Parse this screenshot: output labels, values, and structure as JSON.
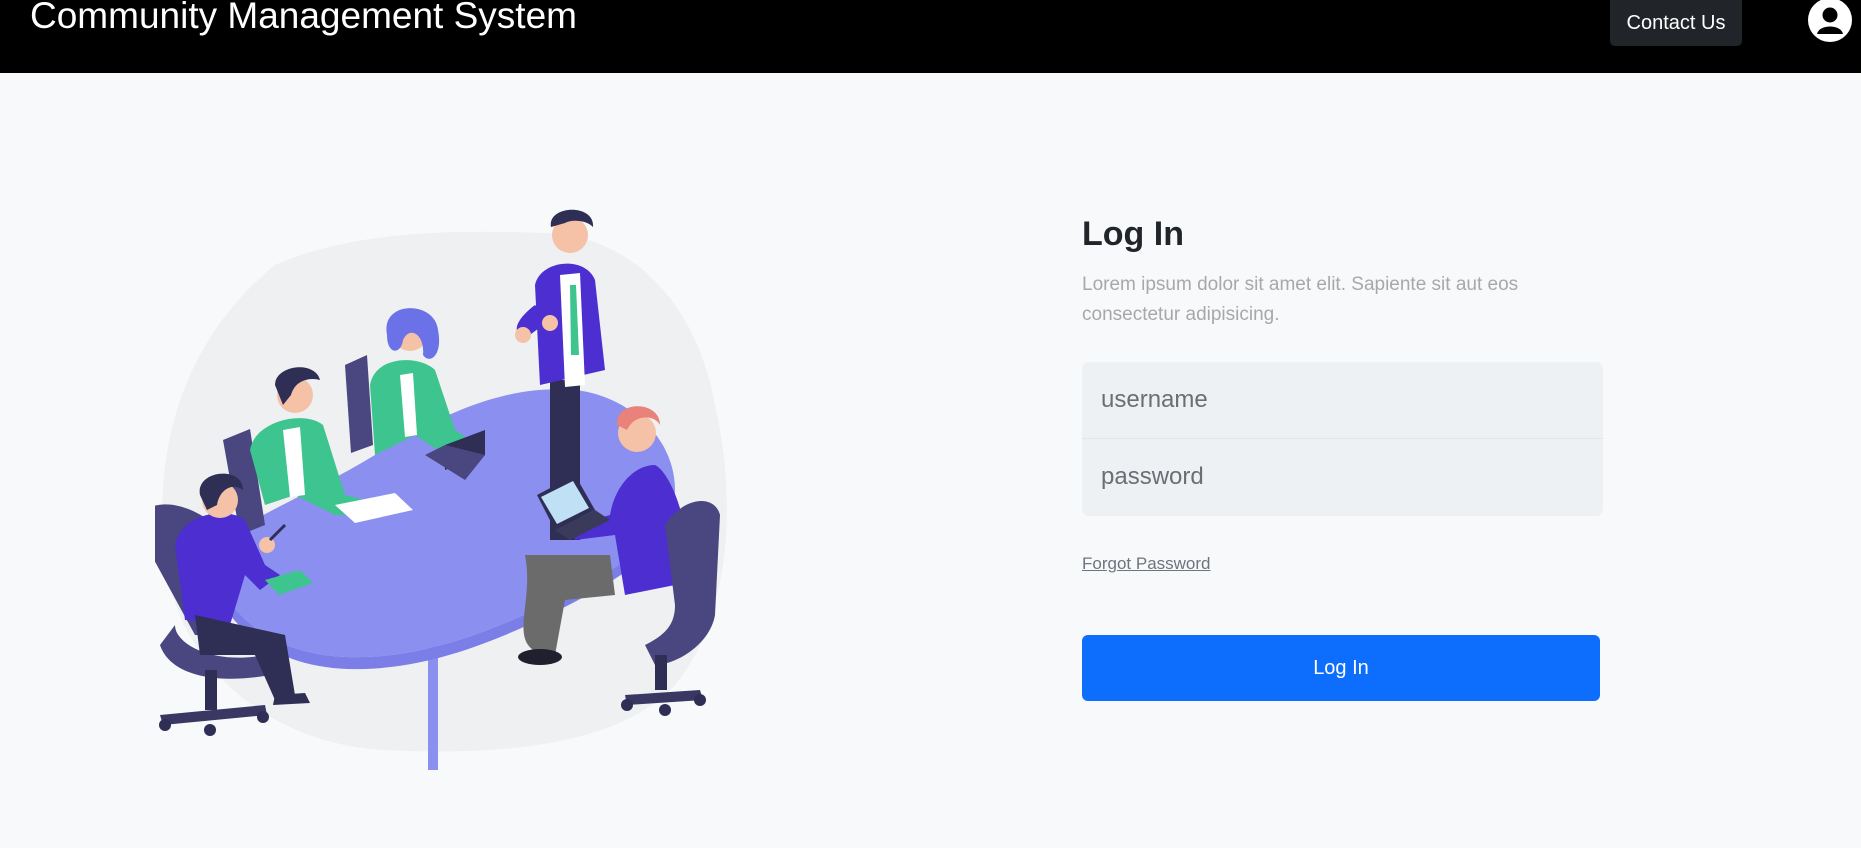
{
  "navbar": {
    "brand": "Community Management System",
    "contact_label": "Contact Us",
    "user_icon": "user-circle-icon"
  },
  "illustration": {
    "icon": "team-meeting-illustration"
  },
  "login": {
    "title": "Log In",
    "description": "Lorem ipsum dolor sit amet elit. Sapiente sit aut eos consectetur adipisicing.",
    "username_placeholder": "username",
    "password_placeholder": "password",
    "forgot_label": "Forgot Password",
    "submit_label": "Log In"
  },
  "colors": {
    "navbar_bg": "#000000",
    "primary": "#0d6efd",
    "page_bg": "#f8f9fb",
    "table": "#8b8ff0",
    "suit_purple": "#4c2ed1",
    "shirt_green": "#3ec48e"
  }
}
